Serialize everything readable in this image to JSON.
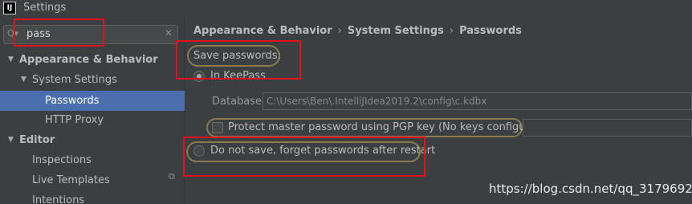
{
  "window": {
    "title": "Settings",
    "app_icon_text": "IJ"
  },
  "search": {
    "value": "pass",
    "icon": "search-icon",
    "clear_icon": "close-icon"
  },
  "tree": {
    "appearance": "Appearance & Behavior",
    "system_settings": "System Settings",
    "passwords": "Passwords",
    "http_proxy": "HTTP Proxy",
    "editor": "Editor",
    "inspections": "Inspections",
    "live_templates": "Live Templates",
    "intentions": "Intentions"
  },
  "breadcrumb": [
    "Appearance & Behavior",
    "System Settings",
    "Passwords"
  ],
  "passwords": {
    "save_label": "Save passwords:",
    "in_keepass": "In KeePass",
    "database_label": "Database:",
    "database_path": "C:\\Users\\Ben\\.IntelliJIdea2019.2\\config\\c.kdbx",
    "protect_label": "Protect master password using PGP key (No keys configured)",
    "do_not_save": "Do not save, forget passwords after restart"
  },
  "watermark": "https://blog.csdn.net/qq_31796925",
  "colors": {
    "accent": "#4b6eaf",
    "annotation_red": "#e0121a",
    "annotation_oval": "#8b7a4f"
  }
}
